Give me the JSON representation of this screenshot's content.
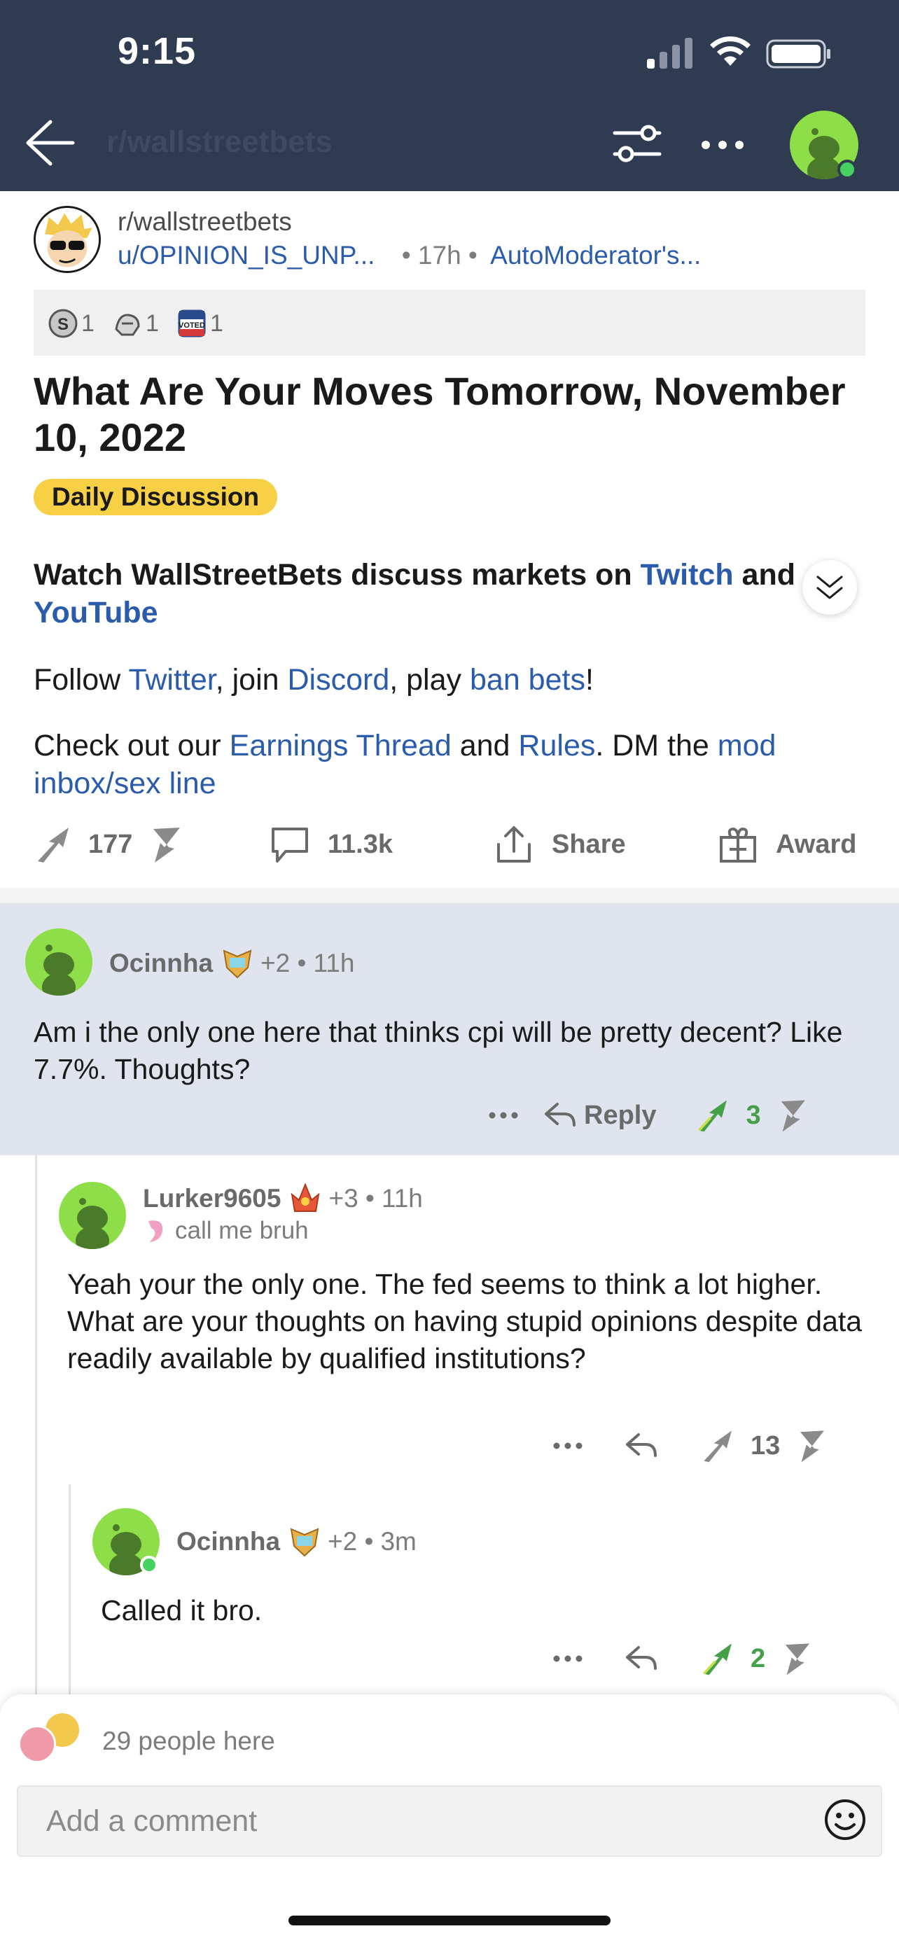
{
  "status_bar": {
    "time": "9:15"
  },
  "nav": {
    "subreddit": "r/wallstreetbets",
    "back_icon": "back-arrow-icon",
    "filter_icon": "sort-filter-icon",
    "more_icon": "more-dots-icon"
  },
  "post": {
    "subreddit": "r/wallstreetbets",
    "author": "u/OPINION_IS_UNP...",
    "age": "• 17h •",
    "author_flair": "AutoModerator's...",
    "awards": [
      {
        "icon": "silver-award-icon",
        "count": "1"
      },
      {
        "icon": "helpful-award-icon",
        "count": "1"
      },
      {
        "icon": "voted-award-icon",
        "count": "1"
      }
    ],
    "title": "What Are Your Moves Tomorrow, November 10, 2022",
    "flair": "Daily Discussion",
    "body": {
      "p1_text": "Watch WallStreetBets discuss markets on ",
      "p1_link1": "Twitch",
      "p1_mid": " and ",
      "p1_link2": "YouTube",
      "p2_a": "Follow ",
      "p2_link1": "Twitter",
      "p2_b": ", join ",
      "p2_link2": "Discord",
      "p2_c": ", play ",
      "p2_link3": "ban bets",
      "p2_d": "!",
      "p3_a": "Check out our ",
      "p3_link1": "Earnings Thread",
      "p3_b": " and ",
      "p3_link2": "Rules",
      "p3_c": ". DM the ",
      "p3_link3": "mod inbox/sex line"
    },
    "actions": {
      "upvotes": "177",
      "comments": "11.3k",
      "share": "Share",
      "award": "Award"
    }
  },
  "comments": [
    {
      "username": "Ocinnha",
      "karma": "+2 •",
      "age": "11h",
      "text": "Am i the only one here that thinks cpi will be pretty decent? Like 7.7%. Thoughts?",
      "reply_label": "Reply",
      "score": "3"
    },
    {
      "username": "Lurker9605",
      "karma": "+3 •",
      "age": "11h",
      "flair": "call me bruh",
      "text": "Yeah your the only one. The fed seems to think a lot higher. What are your thoughts on having stupid opinions despite data readily available by qualified institutions?",
      "score": "13"
    },
    {
      "username": "Ocinnha",
      "karma": "+2 •",
      "age": "3m",
      "text": "Called it bro.",
      "score": "2"
    }
  ],
  "composer": {
    "people_here": "29 people here",
    "placeholder": "Add a comment"
  },
  "colors": {
    "nav_bg": "#2f3b51",
    "link": "#2b5bab",
    "flair_bg": "#f7d046",
    "highlight": "#dfe4ef",
    "upvote_green": "#46a04a"
  }
}
